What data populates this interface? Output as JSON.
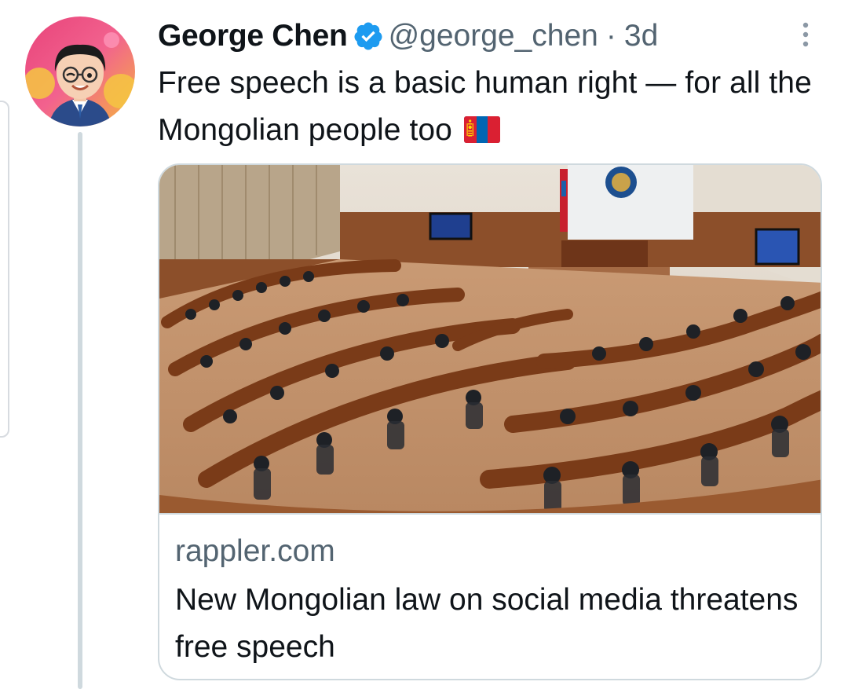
{
  "tweet": {
    "display_name": "George Chen",
    "handle": "@george_chen",
    "separator": "·",
    "timestamp": "3d",
    "text": "Free speech is a basic human right — for all the Mongolian people too",
    "flag_icon": "mongolia-flag-icon",
    "verified_icon": "verified-badge-icon",
    "more_icon": "more-vertical-icon"
  },
  "card": {
    "domain": "rappler.com",
    "title": "New Mongolian law on social media threatens free speech",
    "image": "parliament-chamber-photo"
  },
  "colors": {
    "verified_blue": "#1d9bf0",
    "secondary_text": "#536471",
    "border": "#cfd9de",
    "flag_red": "#da2032",
    "flag_blue": "#0066b3",
    "flag_yellow": "#ffd900"
  }
}
